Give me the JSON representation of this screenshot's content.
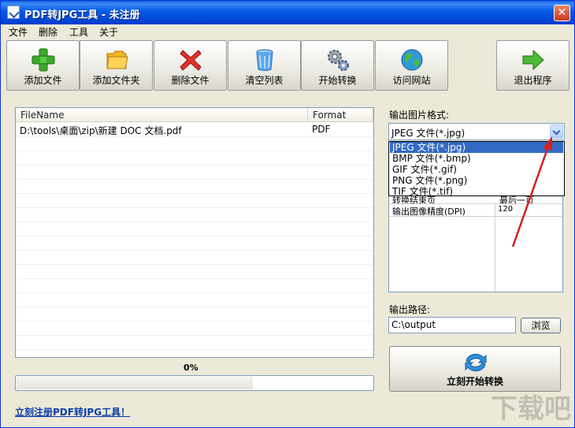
{
  "window": {
    "title": "PDF转JPG工具 - 未注册",
    "close": "✕"
  },
  "menu": [
    "文件",
    "删除",
    "工具",
    "关于"
  ],
  "toolbar": {
    "add_file": "添加文件",
    "add_folder": "添加文件夹",
    "delete_file": "删除文件",
    "clear_list": "清空列表",
    "start_convert": "开始转换",
    "visit_site": "访问网站",
    "exit": "退出程序"
  },
  "file_table": {
    "columns": [
      "FileName",
      "Format"
    ],
    "rows": [
      {
        "filename": "D:\\tools\\桌面\\zip\\新建 DOC 文档.pdf",
        "format": "PDF"
      }
    ]
  },
  "progress": {
    "label": "0%",
    "value": 0
  },
  "register_link": "立刻注册PDF转JPG工具！",
  "output_format": {
    "label": "输出图片格式:",
    "selected": "JPEG 文件(*.jpg)",
    "options": [
      "JPEG 文件(*.jpg)",
      "BMP 文件(*.bmp)",
      "GIF 文件(*.gif)",
      "PNG 文件(*.png)",
      "TIF 文件(*.tif)"
    ]
  },
  "settings": {
    "rows": [
      {
        "key": "转换结束页",
        "value": "最后一页"
      },
      {
        "key": "输出图像精度(DPI)",
        "value": "120"
      }
    ]
  },
  "output_path": {
    "label": "输出路径:",
    "value": "C:\\output",
    "browse": "浏览"
  },
  "convert_now": "立刻开始转换",
  "watermark": "下载吧",
  "colors": {
    "accent": "#316ac5",
    "titlebar": "#0558e6",
    "arrow": "#d42020"
  }
}
